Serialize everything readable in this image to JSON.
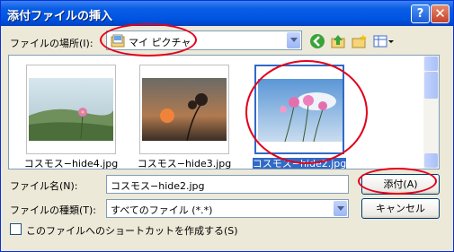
{
  "title": "添付ファイルの挿入",
  "help_glyph": "?",
  "close_glyph": "✕",
  "location_label": "ファイルの場所(I):",
  "location_value": "マイ ピクチャ",
  "files": [
    {
      "name": "コスモス−hide4.jpg",
      "selected": false
    },
    {
      "name": "コスモス−hide3.jpg",
      "selected": false
    },
    {
      "name": "コスモス−hide2.jpg",
      "selected": true
    }
  ],
  "filename_label": "ファイル名(N):",
  "filename_value": "コスモス−hide2.jpg",
  "filetype_label": "ファイルの種類(T):",
  "filetype_value": "すべてのファイル (*.*)",
  "attach_button": "添付(A)",
  "cancel_button": "キャンセル",
  "shortcut_checkbox_label": "このファイルへのショートカットを作成する(S)",
  "shortcut_checked": false,
  "toolbar_icons": [
    "back-icon",
    "up-folder-icon",
    "new-folder-icon",
    "view-menu-icon"
  ],
  "annotation_color": "#e3001b"
}
